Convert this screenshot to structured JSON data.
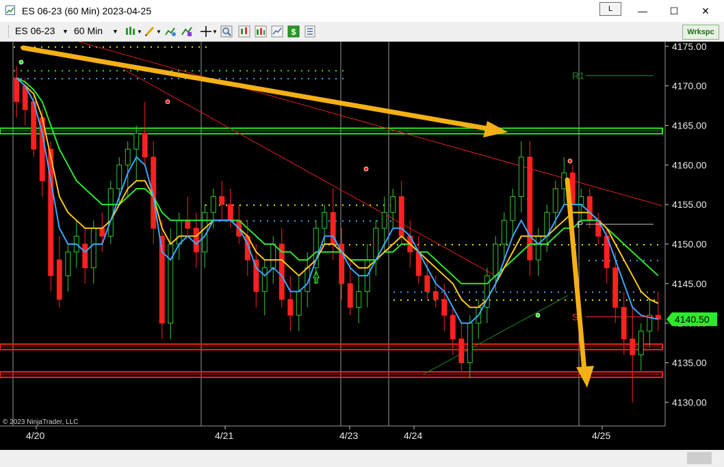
{
  "window": {
    "title": "ES 06-23 (60 Min)  2023-04-25",
    "link_button": "L",
    "minimize_glyph": "—",
    "maximize_glyph": "☐",
    "close_glyph": "✕"
  },
  "toolbar": {
    "instrument": "ES 06-23",
    "interval": "60 Min",
    "workspace_button": "Wrkspc",
    "icons": [
      "bar-style-icon",
      "drawing-tool-icon",
      "indicator-icon",
      "crosshair-icon",
      "zoom-icon",
      "data-series-icon",
      "strategy-icon",
      "chart-trader-icon",
      "dollar-icon",
      "properties-icon"
    ]
  },
  "chart": {
    "copyright": "© 2023 NinjaTrader, LLC",
    "price_labels": [
      "4175.00",
      "4170.00",
      "4165.00",
      "4160.00",
      "4155.00",
      "4150.00",
      "4145.00",
      "4140.00",
      "4135.00",
      "4130.00"
    ],
    "date_labels": [
      "4/20",
      "4/21",
      "4/23",
      "4/24",
      "4/25"
    ],
    "current_price": "4140.50",
    "pivot_labels": [
      "R1",
      "P",
      "S"
    ],
    "colors": {
      "background": "#000000",
      "up_candle": "#32cd32",
      "down_candle": "#ff2020",
      "ema_fast": "#3aa8ff",
      "ema_mid": "#ffc81e",
      "ema_slow": "#2ee82e",
      "resistance_band": "#2ee82e",
      "support_band": "#ff2020",
      "arrow_annotation": "#f5b015",
      "price_tag": "#2ee82e"
    }
  },
  "chart_data": {
    "type": "candlestick",
    "ylim": [
      4127,
      4175.5
    ],
    "yticks": [
      4175,
      4170,
      4165,
      4160,
      4155,
      4150,
      4145,
      4140,
      4135,
      4130
    ],
    "xticks": [
      "4/20",
      "4/21",
      "4/23",
      "4/24",
      "4/25"
    ],
    "last_price": 4140.5,
    "horizontal_levels": [
      {
        "price": 4164.3,
        "color": "green"
      },
      {
        "price": 4137.0,
        "color": "red"
      },
      {
        "price": 4133.5,
        "color": "red"
      }
    ],
    "pivots": [
      {
        "label": "R1",
        "price": 4171.3
      },
      {
        "price": 4152.5,
        "label": "P"
      },
      {
        "label": "S",
        "price": 4140.8
      }
    ],
    "candles": [
      [
        4171,
        4172.5,
        4166,
        4168
      ],
      [
        4170,
        4171,
        4165,
        4167
      ],
      [
        4168,
        4169,
        4161,
        4162
      ],
      [
        4166,
        4167,
        4156,
        4158
      ],
      [
        4162,
        4163,
        4144,
        4146
      ],
      [
        4148,
        4151,
        4142,
        4143
      ],
      [
        4146,
        4150,
        4144,
        4149
      ],
      [
        4149,
        4153,
        4147,
        4151
      ],
      [
        4150,
        4152,
        4145,
        4147
      ],
      [
        4147,
        4153,
        4145,
        4152
      ],
      [
        4152,
        4154,
        4149,
        4151
      ],
      [
        4151,
        4158,
        4150,
        4157
      ],
      [
        4157,
        4161,
        4155,
        4160
      ],
      [
        4160,
        4163,
        4156,
        4162
      ],
      [
        4162,
        4165,
        4158,
        4164
      ],
      [
        4164,
        4168,
        4160,
        4161
      ],
      [
        4161,
        4163,
        4150,
        4152
      ],
      [
        4151,
        4153,
        4138,
        4140
      ],
      [
        4140,
        4152,
        4138,
        4150
      ],
      [
        4150,
        4154,
        4148,
        4153
      ],
      [
        4153,
        4156,
        4151,
        4152
      ],
      [
        4152,
        4154,
        4147,
        4149
      ],
      [
        4149,
        4155,
        4147,
        4154
      ],
      [
        4154,
        4157,
        4152,
        4156
      ],
      [
        4156,
        4158,
        4153,
        4155
      ],
      [
        4155,
        4157,
        4152,
        4153
      ],
      [
        4153,
        4155,
        4150,
        4151
      ],
      [
        4151,
        4153,
        4146,
        4148
      ],
      [
        4148,
        4150,
        4142,
        4144
      ],
      [
        4144,
        4148,
        4141,
        4147
      ],
      [
        4147,
        4151,
        4145,
        4150
      ],
      [
        4150,
        4152,
        4142,
        4143
      ],
      [
        4143,
        4146,
        4139,
        4141
      ],
      [
        4141,
        4146,
        4139,
        4144
      ],
      [
        4144,
        4149,
        4142,
        4147
      ],
      [
        4147,
        4153,
        4145,
        4152
      ],
      [
        4152,
        4155,
        4150,
        4154
      ],
      [
        4154,
        4157,
        4148,
        4150
      ],
      [
        4150,
        4152,
        4143,
        4145
      ],
      [
        4145,
        4148,
        4141,
        4142
      ],
      [
        4142,
        4146,
        4140,
        4144
      ],
      [
        4144,
        4150,
        4142,
        4148
      ],
      [
        4148,
        4153,
        4146,
        4152
      ],
      [
        4152,
        4156,
        4149,
        4154
      ],
      [
        4154,
        4157,
        4152,
        4156
      ],
      [
        4156,
        4158,
        4150,
        4151
      ],
      [
        4151,
        4153,
        4147,
        4149
      ],
      [
        4149,
        4151,
        4145,
        4146
      ],
      [
        4146,
        4148,
        4143,
        4144
      ],
      [
        4144,
        4146,
        4142,
        4143
      ],
      [
        4143,
        4145,
        4139,
        4141
      ],
      [
        4141,
        4142,
        4136,
        4138
      ],
      [
        4138,
        4140,
        4134,
        4135
      ],
      [
        4135,
        4141,
        4133,
        4140
      ],
      [
        4140,
        4143,
        4138,
        4142
      ],
      [
        4142,
        4147,
        4140,
        4146
      ],
      [
        4146,
        4151,
        4144,
        4150
      ],
      [
        4150,
        4154,
        4148,
        4153
      ],
      [
        4153,
        4157,
        4151,
        4156
      ],
      [
        4156,
        4163,
        4154,
        4161
      ],
      [
        4161,
        4163,
        4146,
        4148
      ],
      [
        4148,
        4152,
        4146,
        4151
      ],
      [
        4151,
        4155,
        4149,
        4154
      ],
      [
        4154,
        4158,
        4152,
        4157
      ],
      [
        4157,
        4161,
        4155,
        4159
      ],
      [
        4159,
        4160,
        4154,
        4155
      ],
      [
        4155,
        4157,
        4153,
        4156
      ],
      [
        4156,
        4157,
        4152,
        4153
      ],
      [
        4153,
        4154,
        4150,
        4151
      ],
      [
        4151,
        4152,
        4145,
        4147
      ],
      [
        4147,
        4149,
        4140,
        4142
      ],
      [
        4142,
        4144,
        4136,
        4138
      ],
      [
        4138,
        4142,
        4130,
        4136
      ],
      [
        4136,
        4140,
        4134,
        4139
      ],
      [
        4139,
        4143,
        4137,
        4141
      ],
      [
        4141,
        4144,
        4139,
        4140.5
      ]
    ],
    "series": [
      {
        "name": "EMA fast",
        "values": [
          4171,
          4170,
          4168,
          4164,
          4158,
          4152,
          4150,
          4150,
          4149,
          4150,
          4150,
          4153,
          4156,
          4159,
          4161,
          4160,
          4156,
          4149,
          4148,
          4150,
          4151,
          4150,
          4151,
          4153,
          4153,
          4153,
          4152,
          4150,
          4147,
          4146,
          4147,
          4146,
          4144,
          4144,
          4145,
          4148,
          4151,
          4151,
          4149,
          4147,
          4146,
          4146,
          4148,
          4150,
          4152,
          4152,
          4151,
          4149,
          4147,
          4145,
          4144,
          4142,
          4140,
          4140,
          4141,
          4143,
          4145,
          4148,
          4151,
          4153,
          4151,
          4150,
          4151,
          4153,
          4155,
          4155,
          4155,
          4154,
          4153,
          4151,
          4148,
          4145,
          4142,
          4141,
          4140.7,
          4140.5
        ]
      },
      {
        "name": "EMA mid",
        "values": [
          4171,
          4170,
          4169,
          4166,
          4161,
          4156,
          4154,
          4153,
          4152,
          4152,
          4152,
          4153,
          4155,
          4157,
          4158,
          4158,
          4156,
          4152,
          4150,
          4151,
          4151,
          4151,
          4152,
          4153,
          4153,
          4153,
          4152,
          4151,
          4149,
          4148,
          4148,
          4148,
          4147,
          4146,
          4147,
          4148,
          4150,
          4150,
          4149,
          4148,
          4147,
          4147,
          4148,
          4149,
          4150,
          4151,
          4150,
          4149,
          4148,
          4147,
          4146,
          4145,
          4143,
          4142,
          4142,
          4143,
          4145,
          4147,
          4149,
          4151,
          4151,
          4151,
          4151,
          4152,
          4153,
          4154,
          4154,
          4154,
          4153,
          4152,
          4150,
          4148,
          4146,
          4144,
          4143,
          4142.5
        ]
      },
      {
        "name": "EMA slow",
        "values": [
          4171,
          4170.5,
          4169.5,
          4168,
          4165,
          4162,
          4160,
          4158,
          4157,
          4156,
          4155,
          4155,
          4155,
          4156,
          4157,
          4157,
          4156,
          4154,
          4153,
          4153,
          4153,
          4153,
          4153,
          4153,
          4153,
          4153,
          4153,
          4152,
          4151,
          4150,
          4150,
          4149,
          4149,
          4148,
          4148,
          4149,
          4149,
          4149,
          4149,
          4148,
          4148,
          4148,
          4148,
          4149,
          4149,
          4150,
          4150,
          4149,
          4149,
          4148,
          4147,
          4146,
          4145,
          4145,
          4145,
          4145,
          4146,
          4147,
          4148,
          4149,
          4150,
          4150,
          4150,
          4151,
          4152,
          4152,
          4153,
          4153,
          4153,
          4152,
          4151,
          4150,
          4149,
          4148,
          4147,
          4146
        ]
      }
    ]
  }
}
